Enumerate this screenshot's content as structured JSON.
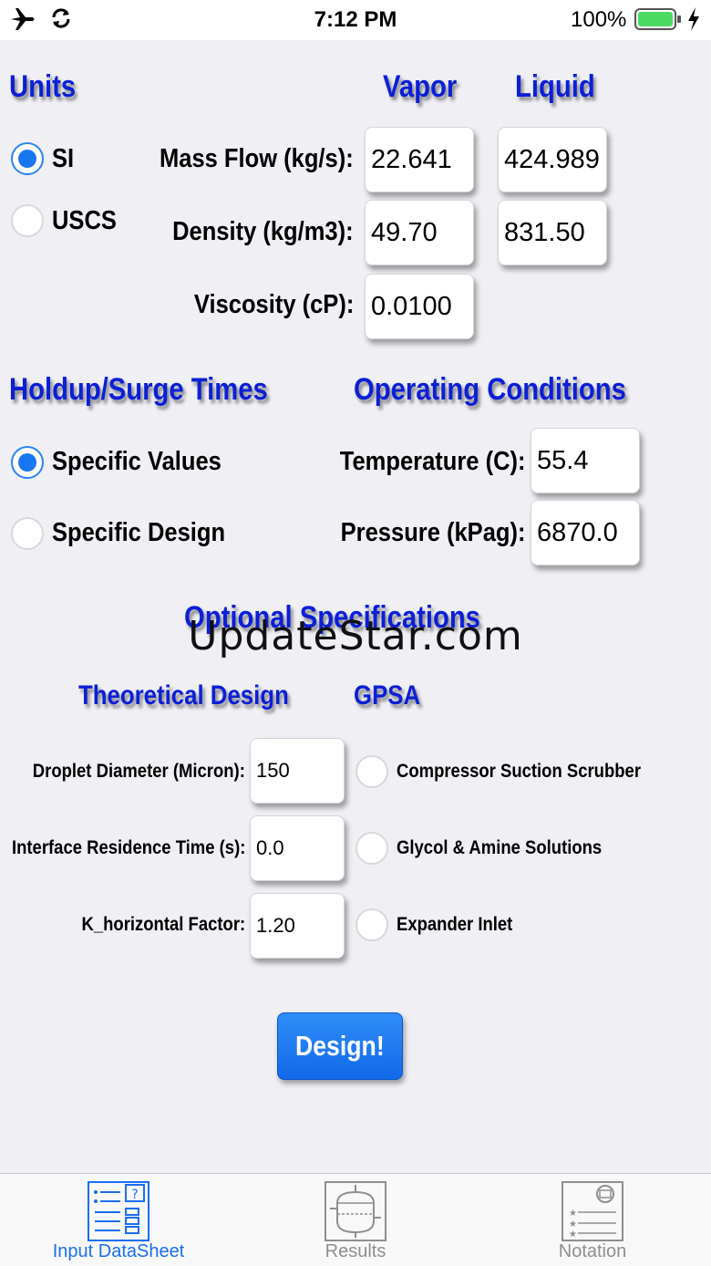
{
  "status_bar": {
    "time": "7:12 PM",
    "battery_percent": "100%",
    "battery_level": 1.0
  },
  "units": {
    "title": "Units",
    "options": [
      {
        "label": "SI",
        "selected": true
      },
      {
        "label": "USCS",
        "selected": false
      }
    ]
  },
  "columns": {
    "vapor": "Vapor",
    "liquid": "Liquid"
  },
  "properties": {
    "mass_flow": {
      "label": "Mass Flow (kg/s):",
      "vapor": "22.641",
      "liquid": "424.989"
    },
    "density": {
      "label": "Density (kg/m3):",
      "vapor": "49.70",
      "liquid": "831.50"
    },
    "viscosity": {
      "label": "Viscosity (cP):",
      "vapor": "0.0100"
    }
  },
  "holdup": {
    "title": "Holdup/Surge Times",
    "options": [
      {
        "label": "Specific Values",
        "selected": true
      },
      {
        "label": "Specific Design",
        "selected": false
      }
    ]
  },
  "operating": {
    "title": "Operating Conditions",
    "temperature": {
      "label": "Temperature (C):",
      "value": "55.4"
    },
    "pressure": {
      "label": "Pressure (kPag):",
      "value": "6870.0"
    }
  },
  "optional": {
    "title": "Optional Specifications",
    "watermark": "UpdateStar.com",
    "theoretical": {
      "title": "Theoretical Design",
      "droplet": {
        "label": "Droplet Diameter (Micron):",
        "value": "150"
      },
      "interface": {
        "label": "Interface Residence Time (s):",
        "value": "0.0"
      },
      "k_factor": {
        "label": "K_horizontal Factor:",
        "value": "1.20"
      }
    },
    "gpsa": {
      "title": "GPSA",
      "options": [
        {
          "label": "Compressor Suction Scrubber",
          "selected": false
        },
        {
          "label": "Glycol & Amine Solutions",
          "selected": false
        },
        {
          "label": "Expander Inlet",
          "selected": false
        }
      ]
    }
  },
  "design_button": "Design!",
  "tabs": [
    {
      "label": "Input DataSheet",
      "icon": "datasheet-icon",
      "active": true
    },
    {
      "label": "Results",
      "icon": "vessel-icon",
      "active": false
    },
    {
      "label": "Notation",
      "icon": "notation-icon",
      "active": false
    }
  ],
  "colors": {
    "accent": "#1a6ef0",
    "section_title": "#0b1fd6",
    "battery": "#4cd964"
  }
}
